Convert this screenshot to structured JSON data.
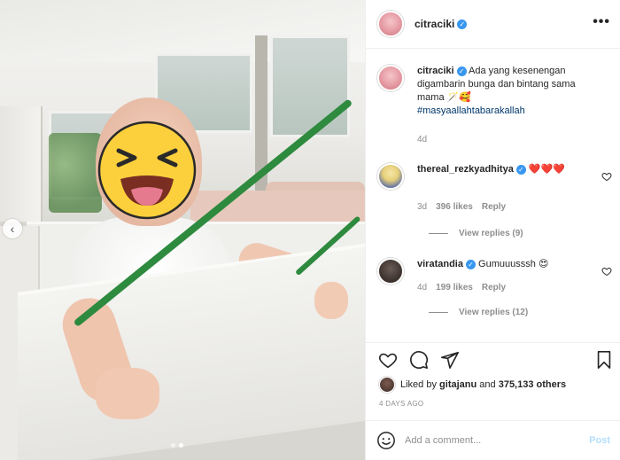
{
  "post": {
    "author": "citraciki",
    "verified": true,
    "more_label": "•••"
  },
  "caption": {
    "user": "citraciki",
    "text": "Ada yang kesenengan digambarin bunga dan bintang sama mama 🪄🥰",
    "hashtag": "#masyaallahtabarakallah",
    "age": "4d"
  },
  "comments": [
    {
      "user": "thereal_rezkyadhitya",
      "text": "❤️❤️❤️",
      "age": "3d",
      "likes": "396 likes",
      "reply_label": "Reply",
      "view_replies": "View replies (9)"
    },
    {
      "user": "viratandia",
      "text": "Gumuuusssh 😍",
      "age": "4d",
      "likes": "199 likes",
      "reply_label": "Reply",
      "view_replies": "View replies (12)"
    }
  ],
  "engagement": {
    "liked_by_prefix": "Liked by",
    "liked_by_user": "gitajanu",
    "liked_by_and": "and",
    "liked_by_count": "375,133 others",
    "timestamp": "4 DAYS AGO"
  },
  "add_comment": {
    "placeholder": "Add a comment...",
    "post_label": "Post"
  },
  "carousel": {
    "prev_label": "‹",
    "slides": 2,
    "active_slide": 2
  },
  "colors": {
    "link": "#00376b",
    "verified": "#3897f0",
    "post_disabled": "#b2dffc",
    "wand": "#2e8a3e"
  }
}
